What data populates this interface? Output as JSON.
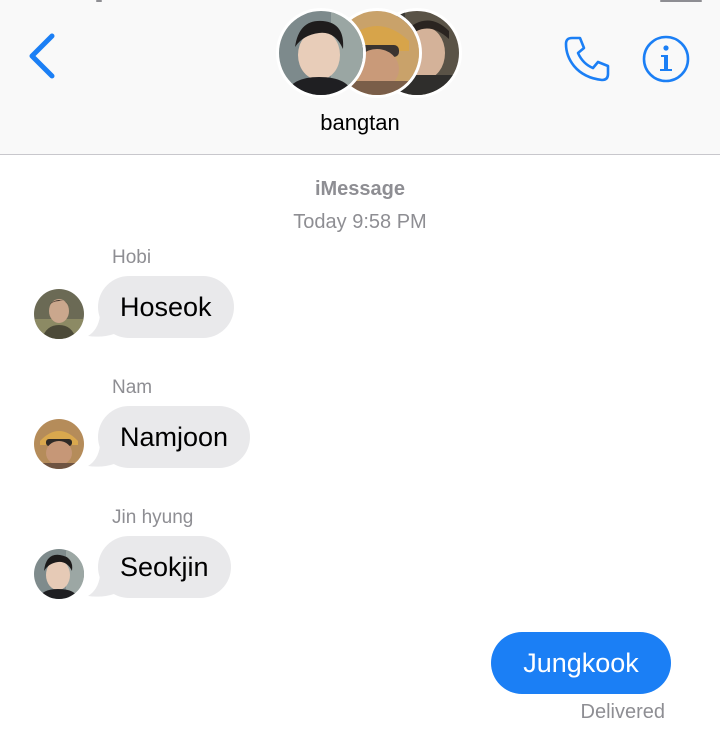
{
  "header": {
    "group_name": "bangtan",
    "icons": {
      "back": "chevron-left-icon",
      "call": "phone-icon",
      "info": "info-icon"
    },
    "accent_color": "#1b7ff5"
  },
  "thread": {
    "service_label": "iMessage",
    "timestamp": "Today 9:58 PM",
    "messages": [
      {
        "sender": "Hobi",
        "text": "Hoseok",
        "direction": "incoming"
      },
      {
        "sender": "Nam",
        "text": "Namjoon",
        "direction": "incoming"
      },
      {
        "sender": "Jin hyung",
        "text": "Seokjin",
        "direction": "incoming"
      },
      {
        "sender": "",
        "text": "Jungkook",
        "direction": "outgoing",
        "status": "Delivered"
      }
    ]
  },
  "colors": {
    "incoming_bubble": "#e9e9eb",
    "outgoing_bubble": "#1b7ff5",
    "secondary_text": "#8e8e93"
  }
}
